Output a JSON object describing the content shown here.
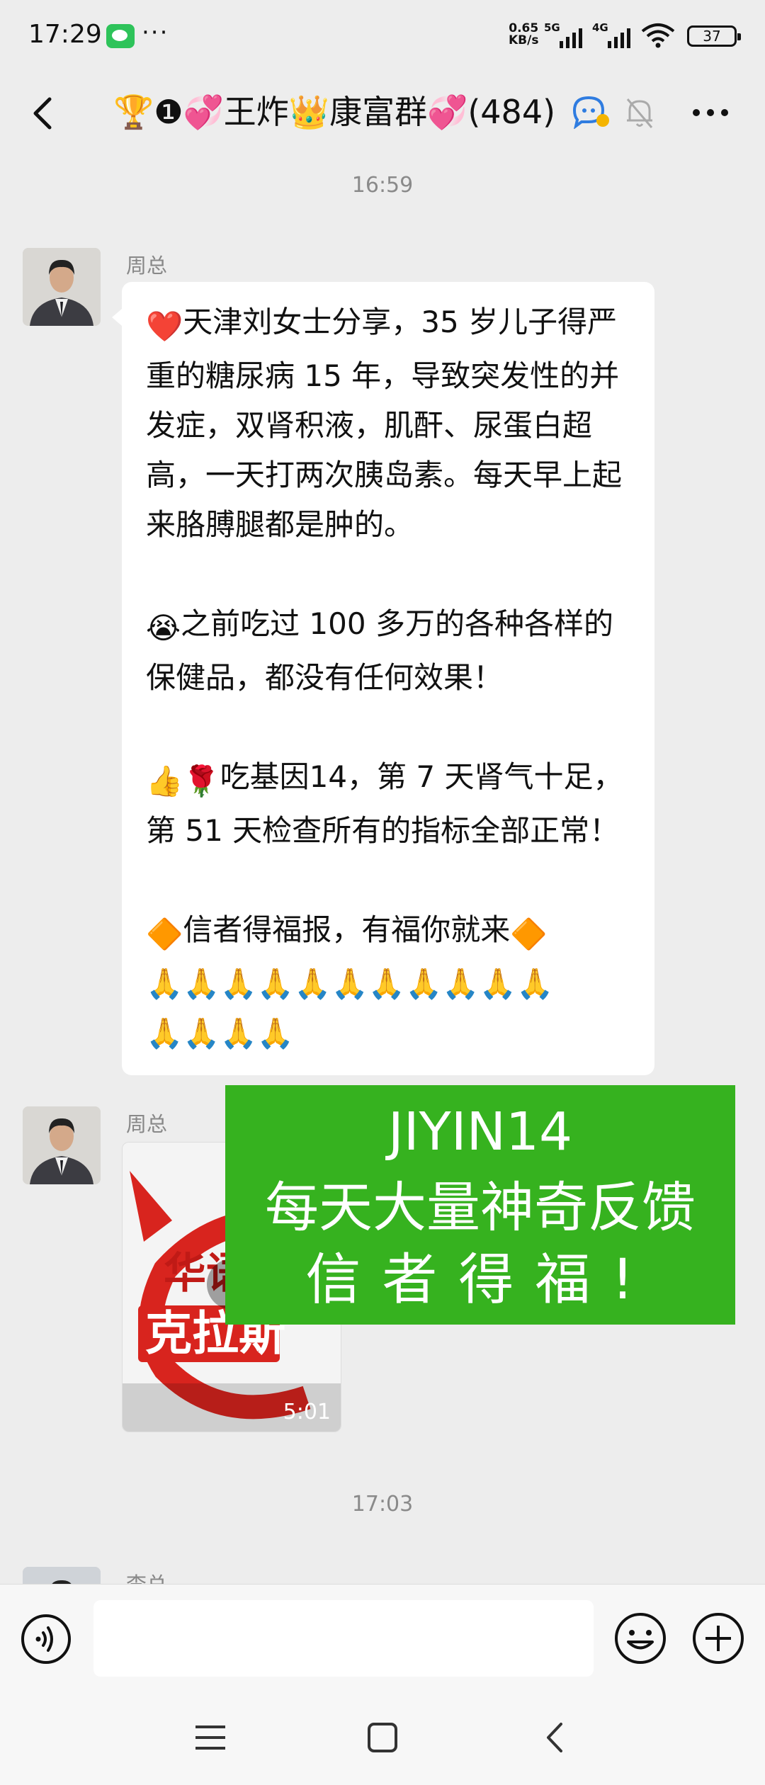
{
  "status_bar": {
    "time": "17:29",
    "more": "···",
    "net_speed_value": "0.65",
    "net_speed_unit": "KB/s",
    "sim1": "5G",
    "sim2": "4G",
    "battery": "37"
  },
  "header": {
    "title": "🏆❶💞王炸👑康富群💞(484)"
  },
  "timestamps": [
    "16:59",
    "17:03"
  ],
  "messages": [
    {
      "sender": "周总",
      "paragraphs": [
        "天津刘女士分享，35 岁儿子得严重的糖尿病 15 年，导致突发性的并发症，双肾积液，肌酐、尿蛋白超高，一天打两次胰岛素。每天早上起来胳膊腿都是肿的。",
        "之前吃过 100 多万的各种各样的保健品，都没有任何效果！",
        "吃基因14，第 7 天肾气十足，第 51 天检查所有的指标全部正常！",
        "信者得福报，有福你就来"
      ],
      "emoji": {
        "p1": "❤️",
        "p2": "😭",
        "p3": "👍🌹",
        "p4_left": "🔶",
        "p4_right": "🔶",
        "pray_row1": "🙏🙏🙏🙏🙏🙏🙏🙏🙏🙏🙏",
        "pray_row2": "🙏🙏🙏🙏"
      }
    },
    {
      "sender": "周总",
      "type": "video",
      "duration": "5:01",
      "thumb_text_top": "华语",
      "thumb_text_main": "克拉斯"
    },
    {
      "sender": "李总"
    }
  ],
  "overlay": {
    "line1": "JIYIN14",
    "line2": "每天大量神奇反馈",
    "line3": "信者得福!"
  },
  "input": {
    "placeholder": ""
  },
  "colors": {
    "background": "#ededed",
    "bubble": "#ffffff",
    "overlay_green": "#36b21f",
    "video_red": "#d8241e"
  }
}
